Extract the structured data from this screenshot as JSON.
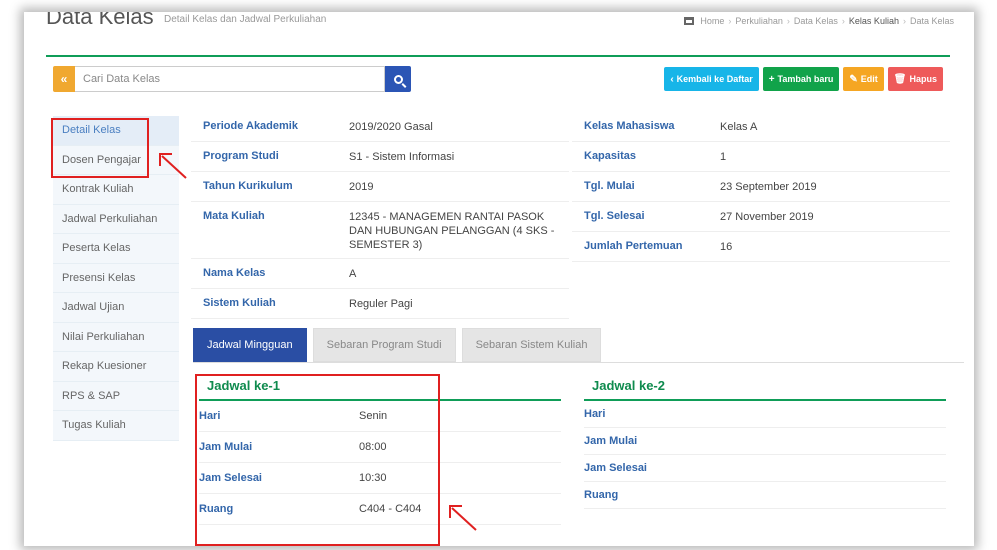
{
  "header": {
    "title": "Data Kelas",
    "subtitle": "Detail Kelas dan Jadwal Perkuliahan",
    "breadcrumb": [
      "Home",
      "Perkuliahan",
      "Data Kelas",
      "Kelas Kuliah",
      "Data Kelas"
    ]
  },
  "search": {
    "collapse_label": "«",
    "placeholder": "Cari Data Kelas"
  },
  "toolbar": {
    "back_label": "Kembali ke Daftar",
    "add_label": "Tambah baru",
    "edit_label": "Edit",
    "delete_label": "Hapus"
  },
  "sidebar": {
    "items": [
      {
        "label": "Detail Kelas"
      },
      {
        "label": "Dosen Pengajar"
      },
      {
        "label": "Kontrak Kuliah"
      },
      {
        "label": "Jadwal Perkuliahan"
      },
      {
        "label": "Peserta Kelas"
      },
      {
        "label": "Presensi Kelas"
      },
      {
        "label": "Jadwal Ujian"
      },
      {
        "label": "Nilai Perkuliahan"
      },
      {
        "label": "Rekap Kuesioner"
      },
      {
        "label": "RPS & SAP"
      },
      {
        "label": "Tugas Kuliah"
      }
    ]
  },
  "detail": {
    "left": [
      {
        "label": "Periode Akademik",
        "value": "2019/2020 Gasal"
      },
      {
        "label": "Program Studi",
        "value": "S1 - Sistem Informasi"
      },
      {
        "label": "Tahun Kurikulum",
        "value": "2019"
      },
      {
        "label": "Mata Kuliah",
        "value": "12345 - MANAGEMEN RANTAI PASOK DAN HUBUNGAN PELANGGAN (4 SKS - SEMESTER 3)"
      },
      {
        "label": "Nama Kelas",
        "value": "A"
      },
      {
        "label": "Sistem Kuliah",
        "value": "Reguler Pagi"
      }
    ],
    "right": [
      {
        "label": "Kelas Mahasiswa",
        "value": "Kelas A"
      },
      {
        "label": "Kapasitas",
        "value": "1"
      },
      {
        "label": "Tgl. Mulai",
        "value": "23 September 2019"
      },
      {
        "label": "Tgl. Selesai",
        "value": "27 November 2019"
      },
      {
        "label": "Jumlah Pertemuan",
        "value": "16"
      }
    ]
  },
  "tabs": [
    {
      "label": "Jadwal Mingguan"
    },
    {
      "label": "Sebaran Program Studi"
    },
    {
      "label": "Sebaran Sistem Kuliah"
    }
  ],
  "schedule": [
    {
      "title": "Jadwal ke-1",
      "rows": [
        {
          "label": "Hari",
          "value": "Senin"
        },
        {
          "label": "Jam Mulai",
          "value": "08:00"
        },
        {
          "label": "Jam Selesai",
          "value": "10:30"
        },
        {
          "label": "Ruang",
          "value": "C404 - C404"
        }
      ]
    },
    {
      "title": "Jadwal ke-2",
      "rows": [
        {
          "label": "Hari",
          "value": ""
        },
        {
          "label": "Jam Mulai",
          "value": ""
        },
        {
          "label": "Jam Selesai",
          "value": ""
        },
        {
          "label": "Ruang",
          "value": ""
        }
      ]
    }
  ],
  "colors": {
    "accent_green": "#0f9d58",
    "primary_blue": "#2a4ea4",
    "label_blue": "#3366aa",
    "annotation_red": "#e02020"
  }
}
